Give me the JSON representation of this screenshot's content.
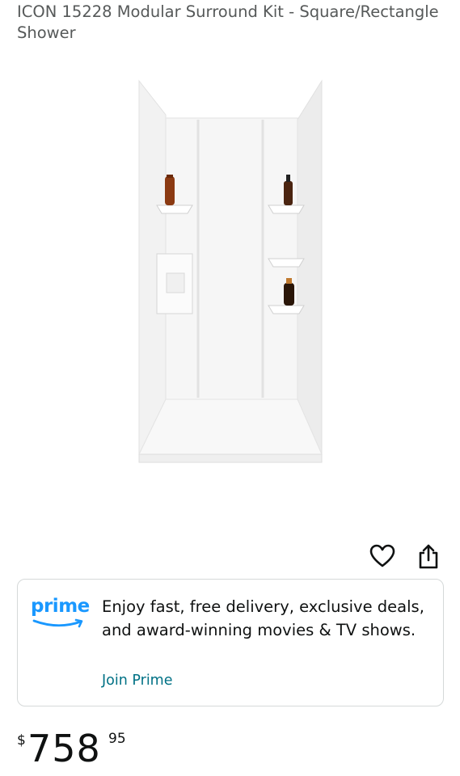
{
  "product": {
    "title": "ICON 15228 Modular Surround Kit - Square/Rectangle Shower"
  },
  "actions": {
    "wishlist_icon": "heart-outline-icon",
    "share_icon": "share-icon"
  },
  "prime": {
    "logo_text": "prime",
    "description": "Enjoy fast, free delivery, exclusive deals, and award-winning movies & TV shows.",
    "join_label": "Join Prime"
  },
  "price": {
    "symbol": "$",
    "whole": "758",
    "fraction": "95"
  },
  "colors": {
    "prime_blue": "#1a98ff",
    "link": "#007185",
    "title_gray": "#565959",
    "card_border": "#d5d9d9"
  }
}
